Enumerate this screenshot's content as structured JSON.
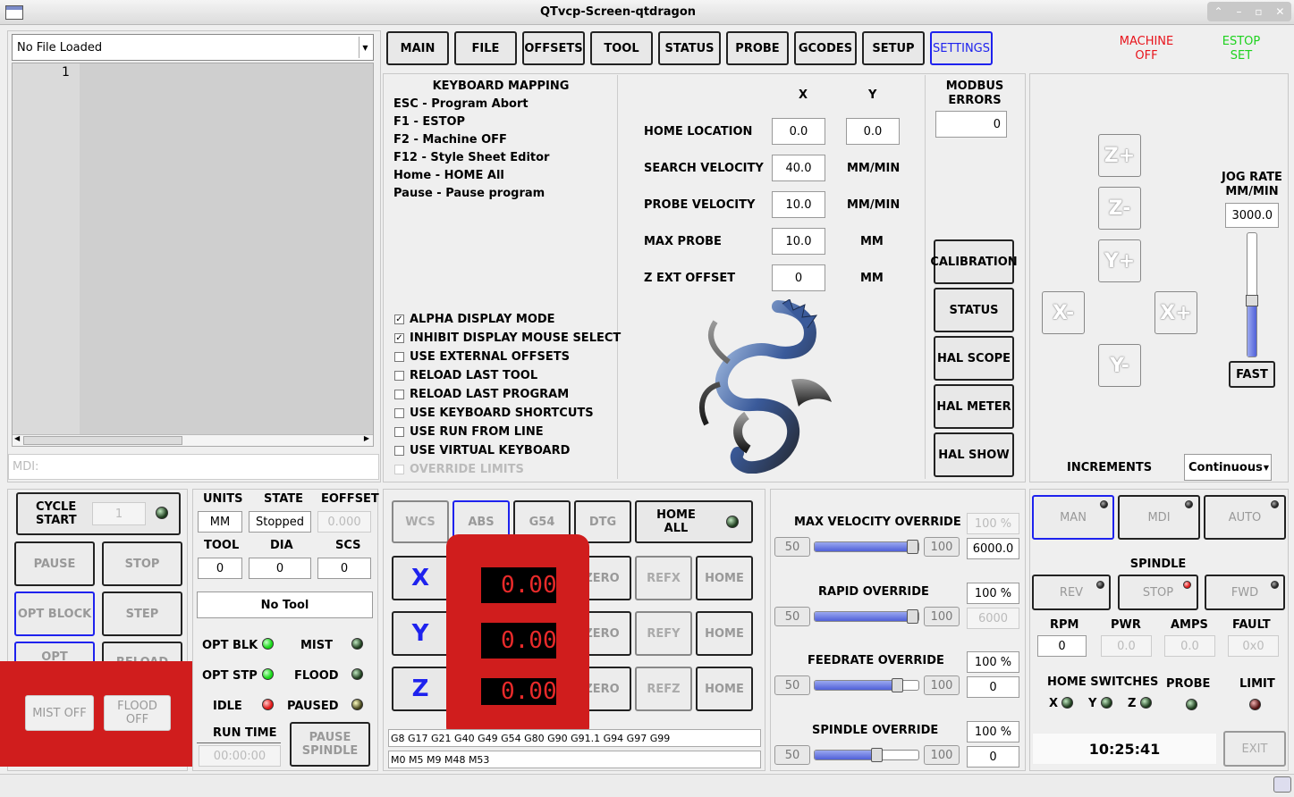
{
  "window": {
    "title": "QTvcp-Screen-qtdragon"
  },
  "file": {
    "selected": "No File Loaded",
    "line_no": "1",
    "mdi_placeholder": "MDI:"
  },
  "tabs": [
    "MAIN",
    "FILE",
    "OFFSETS",
    "TOOL",
    "STATUS",
    "PROBE",
    "GCODES",
    "SETUP",
    "SETTINGS"
  ],
  "status_top": {
    "machine": "MACHINE OFF",
    "estop": "ESTOP SET"
  },
  "keyboard": {
    "title": "KEYBOARD MAPPING",
    "items": [
      "ESC - Program Abort",
      "F1 - ESTOP",
      "F2 - Machine OFF",
      "F12 - Style Sheet Editor",
      "Home - HOME All",
      "Pause - Pause program"
    ]
  },
  "options": [
    {
      "label": "ALPHA DISPLAY MODE",
      "checked": "✓"
    },
    {
      "label": "INHIBIT DISPLAY MOUSE SELECT",
      "checked": "✓"
    },
    {
      "label": "USE EXTERNAL OFFSETS",
      "checked": ""
    },
    {
      "label": "RELOAD LAST TOOL",
      "checked": ""
    },
    {
      "label": "RELOAD LAST PROGRAM",
      "checked": ""
    },
    {
      "label": "USE KEYBOARD SHORTCUTS",
      "checked": ""
    },
    {
      "label": "USE RUN FROM LINE",
      "checked": ""
    },
    {
      "label": "USE VIRTUAL KEYBOARD",
      "checked": ""
    },
    {
      "label": "OVERRIDE LIMITS",
      "checked": ""
    }
  ],
  "probe_settings": {
    "col_x": "X",
    "col_y": "Y",
    "home_location": {
      "label": "HOME LOCATION",
      "x": "0.0",
      "y": "0.0"
    },
    "search_velocity": {
      "label": "SEARCH VELOCITY",
      "value": "40.0",
      "unit": "MM/MIN"
    },
    "probe_velocity": {
      "label": "PROBE VELOCITY",
      "value": "10.0",
      "unit": "MM/MIN"
    },
    "max_probe": {
      "label": "MAX PROBE",
      "value": "10.0",
      "unit": "MM"
    },
    "z_ext_offset": {
      "label": "Z EXT OFFSET",
      "value": "0",
      "unit": "MM"
    }
  },
  "modbus": {
    "label": "MODBUS ERRORS",
    "value": "0"
  },
  "tool_buttons": [
    "CALIBRATION",
    "STATUS",
    "HAL SCOPE",
    "HAL METER",
    "HAL SHOW"
  ],
  "jog": {
    "z_plus": "Z+",
    "z_minus": "Z-",
    "y_plus": "Y+",
    "y_minus": "Y-",
    "x_minus": "X-",
    "x_plus": "X+",
    "rate_label": "JOG RATE MM/MIN",
    "rate": "3000.0",
    "fast": "FAST",
    "increments_label": "INCREMENTS",
    "increment": "Continuous",
    "rate_slider_fraction": 0.45
  },
  "controls": {
    "cycle_start": "CYCLE START",
    "start_line": "1",
    "pause": "PAUSE",
    "stop": "STOP",
    "opt_block": "OPT BLOCK",
    "step": "STEP",
    "opt_stop": "OPT",
    "reload": "RELOAD",
    "mist": "MIST OFF",
    "flood": "FLOOD OFF"
  },
  "state": {
    "units_l": "UNITS",
    "state_l": "STATE",
    "eoffset_l": "EOFFSET",
    "units": "MM",
    "state": "Stopped",
    "eoffset": "0.000",
    "tool_l": "TOOL",
    "dia_l": "DIA",
    "scs_l": "SCS",
    "tool": "0",
    "dia": "0",
    "scs": "0",
    "tool_name": "No Tool",
    "opt_blk": "OPT BLK",
    "mist": "MIST",
    "opt_stp": "OPT STP",
    "flood": "FLOOD",
    "idle": "IDLE",
    "paused": "PAUSED",
    "run_time_l": "RUN TIME",
    "run_time": "00:00:00",
    "pause_spindle": "PAUSE SPINDLE"
  },
  "dro": {
    "wcs": "WCS",
    "abs": "ABS",
    "g54": "G54",
    "dtg": "DTG",
    "home_all": "HOME ALL",
    "axes": [
      {
        "name": "X",
        "value": "0.000",
        "zero": "ZERO",
        "ref": "REFX",
        "home": "HOME"
      },
      {
        "name": "Y",
        "value": "0.000",
        "zero": "ZERO",
        "ref": "REFY",
        "home": "HOME"
      },
      {
        "name": "Z",
        "value": "0.000",
        "zero": "ZERO",
        "ref": "REFZ",
        "home": "HOME"
      }
    ],
    "gcodes": "G8 G17 G21 G40 G49 G54 G80 G90 G91.1 G94 G97 G99",
    "mcodes": "M0 M5 M9 M48 M53"
  },
  "overrides": {
    "max_velocity": {
      "label": "MAX VELOCITY OVERRIDE",
      "min": "50",
      "max": "100",
      "pct": "100 %",
      "value": "6000.0",
      "fraction": 1.0
    },
    "rapid": {
      "label": "RAPID OVERRIDE",
      "min": "50",
      "max": "100",
      "pct": "100 %",
      "value": "6000",
      "fraction": 1.0
    },
    "feedrate": {
      "label": "FEEDRATE OVERRIDE",
      "min": "50",
      "max": "100",
      "pct": "100 %",
      "value": "0",
      "fraction": 0.8
    },
    "spindle": {
      "label": "SPINDLE OVERRIDE",
      "min": "50",
      "max": "100",
      "pct": "100 %",
      "value": "0",
      "fraction": 0.6
    }
  },
  "modes": {
    "man": "MAN",
    "mdi": "MDI",
    "auto": "AUTO"
  },
  "spindle": {
    "title": "SPINDLE",
    "rev": "REV",
    "stop": "STOP",
    "fwd": "FWD",
    "rpm_l": "RPM",
    "pwr_l": "PWR",
    "amps_l": "AMPS",
    "fault_l": "FAULT",
    "rpm": "0",
    "pwr": "0.0",
    "amps": "0.0",
    "fault": "0x0"
  },
  "switches": {
    "home_l": "HOME SWITCHES",
    "probe_l": "PROBE",
    "limit_l": "LIMIT",
    "x": "X",
    "y": "Y",
    "z": "Z"
  },
  "clock": "10:25:41",
  "exit": "EXIT",
  "colors": {
    "accent_blue": "#1e22ee",
    "machine_off": "#e8141c",
    "estop_set": "#1ed21e",
    "dro_red": "#e82a2a",
    "overlay_red": "#d01d1d"
  }
}
